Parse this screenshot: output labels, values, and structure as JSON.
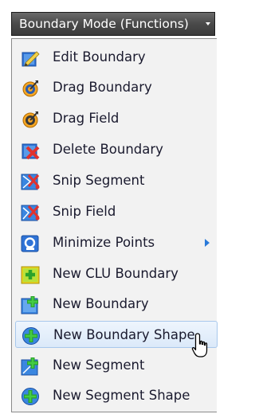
{
  "dropdown": {
    "label": "Boundary Mode (Functions)",
    "arrow_icon": "dropdown-arrow-icon"
  },
  "menu": {
    "items": [
      {
        "label": "Edit Boundary",
        "icon": "edit-boundary-icon"
      },
      {
        "label": "Drag Boundary",
        "icon": "drag-boundary-icon"
      },
      {
        "label": "Drag Field",
        "icon": "drag-field-icon"
      },
      {
        "label": "Delete Boundary",
        "icon": "delete-boundary-icon"
      },
      {
        "label": "Snip Segment",
        "icon": "snip-segment-icon"
      },
      {
        "label": "Snip Field",
        "icon": "snip-field-icon"
      },
      {
        "label": "Minimize Points",
        "icon": "minimize-points-icon",
        "has_submenu": true
      },
      {
        "label": "New CLU Boundary",
        "icon": "new-clu-boundary-icon"
      },
      {
        "label": "New Boundary",
        "icon": "new-boundary-icon"
      },
      {
        "label": "New Boundary Shape",
        "icon": "new-boundary-shape-icon",
        "hovered": true
      },
      {
        "label": "New Segment",
        "icon": "new-segment-icon"
      },
      {
        "label": "New Segment Shape",
        "icon": "new-segment-shape-icon"
      }
    ],
    "hover_color": "#dbe9f9"
  },
  "cursor": {
    "icon": "hand-pointer-icon"
  }
}
